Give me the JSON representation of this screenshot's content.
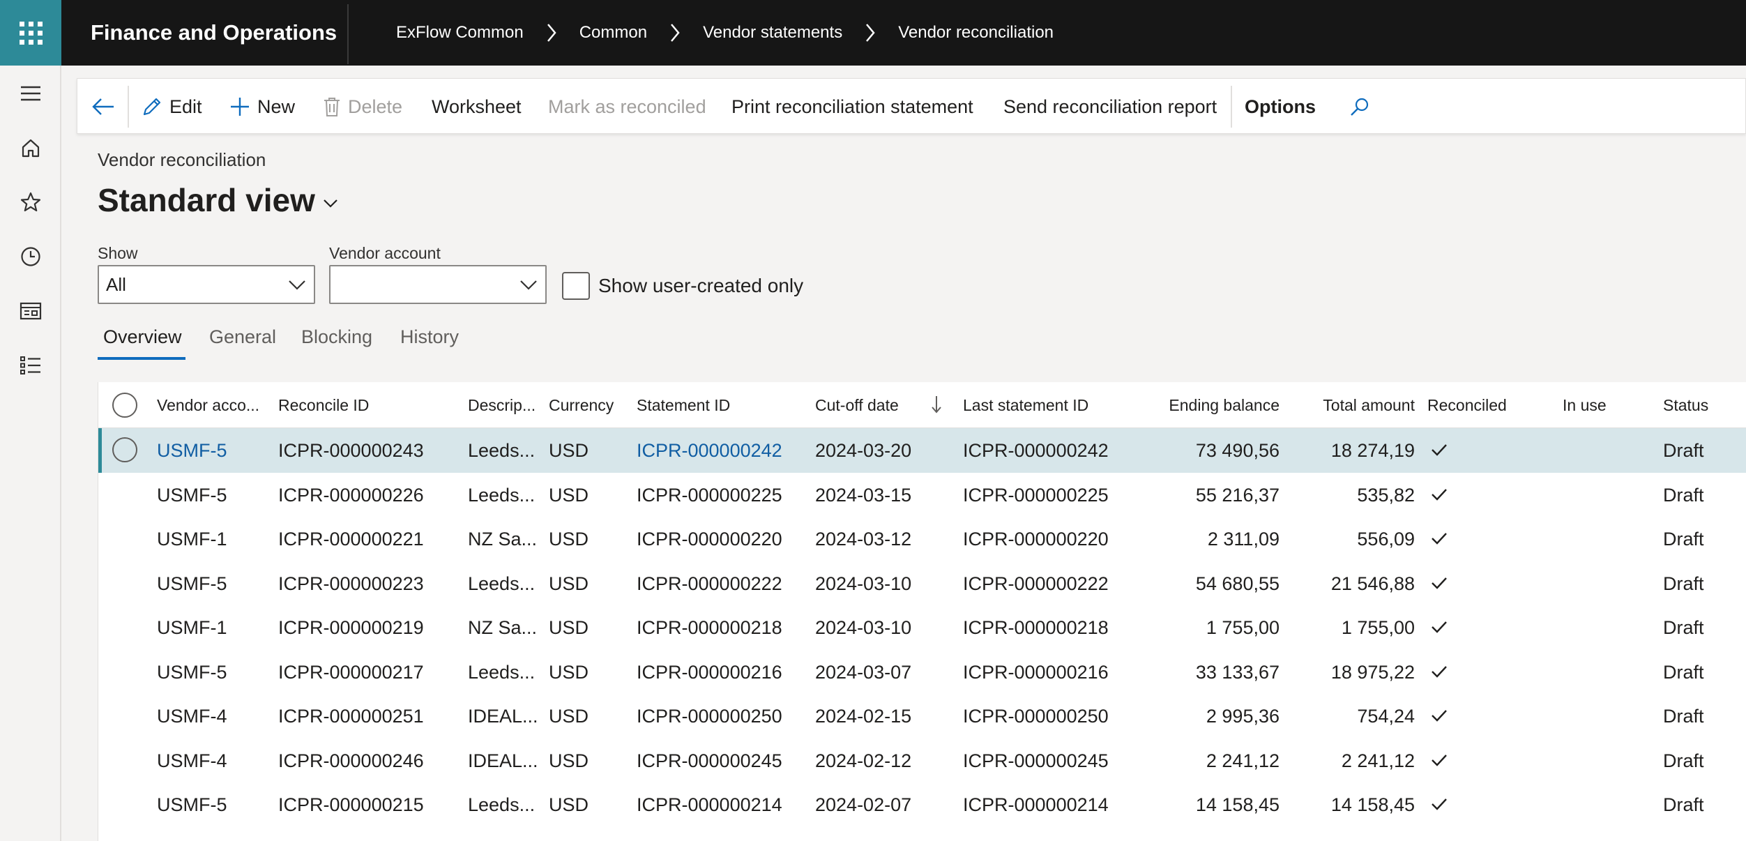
{
  "topbar": {
    "app_title": "Finance and Operations",
    "breadcrumb": [
      "ExFlow Common",
      "Common",
      "Vendor statements",
      "Vendor reconciliation"
    ]
  },
  "actions": {
    "edit": "Edit",
    "new": "New",
    "delete": "Delete",
    "worksheet": "Worksheet",
    "mark_reconciled": "Mark as reconciled",
    "print_statement": "Print reconciliation statement",
    "send_report": "Send reconciliation report",
    "options": "Options"
  },
  "page": {
    "caption": "Vendor reconciliation",
    "view_title": "Standard view"
  },
  "filters": {
    "show_label": "Show",
    "show_value": "All",
    "vendor_label": "Vendor account",
    "vendor_value": "",
    "user_created_label": "Show user-created only"
  },
  "tabs": [
    "Overview",
    "General",
    "Blocking",
    "History"
  ],
  "grid": {
    "headers": {
      "vendor": "Vendor acco...",
      "reconcile_id": "Reconcile ID",
      "description": "Descrip...",
      "currency": "Currency",
      "statement_id": "Statement ID",
      "cutoff": "Cut-off date",
      "last_statement": "Last statement ID",
      "ending_balance": "Ending balance",
      "total_amount": "Total amount",
      "reconciled": "Reconciled",
      "in_use": "In use",
      "status": "Status"
    },
    "rows": [
      {
        "vendor": "USMF-5",
        "reconcile_id": "ICPR-000000243",
        "description": "Leeds...",
        "currency": "USD",
        "statement_id": "ICPR-000000242",
        "cutoff": "2024-03-20",
        "last_statement": "ICPR-000000242",
        "ending_balance": "73 490,56",
        "total_amount": "18 274,19",
        "reconciled": true,
        "in_use": "",
        "status": "Draft"
      },
      {
        "vendor": "USMF-5",
        "reconcile_id": "ICPR-000000226",
        "description": "Leeds...",
        "currency": "USD",
        "statement_id": "ICPR-000000225",
        "cutoff": "2024-03-15",
        "last_statement": "ICPR-000000225",
        "ending_balance": "55 216,37",
        "total_amount": "535,82",
        "reconciled": true,
        "in_use": "",
        "status": "Draft"
      },
      {
        "vendor": "USMF-1",
        "reconcile_id": "ICPR-000000221",
        "description": "NZ Sa...",
        "currency": "USD",
        "statement_id": "ICPR-000000220",
        "cutoff": "2024-03-12",
        "last_statement": "ICPR-000000220",
        "ending_balance": "2 311,09",
        "total_amount": "556,09",
        "reconciled": true,
        "in_use": "",
        "status": "Draft"
      },
      {
        "vendor": "USMF-5",
        "reconcile_id": "ICPR-000000223",
        "description": "Leeds...",
        "currency": "USD",
        "statement_id": "ICPR-000000222",
        "cutoff": "2024-03-10",
        "last_statement": "ICPR-000000222",
        "ending_balance": "54 680,55",
        "total_amount": "21 546,88",
        "reconciled": true,
        "in_use": "",
        "status": "Draft"
      },
      {
        "vendor": "USMF-1",
        "reconcile_id": "ICPR-000000219",
        "description": "NZ Sa...",
        "currency": "USD",
        "statement_id": "ICPR-000000218",
        "cutoff": "2024-03-10",
        "last_statement": "ICPR-000000218",
        "ending_balance": "1 755,00",
        "total_amount": "1 755,00",
        "reconciled": true,
        "in_use": "",
        "status": "Draft"
      },
      {
        "vendor": "USMF-5",
        "reconcile_id": "ICPR-000000217",
        "description": "Leeds...",
        "currency": "USD",
        "statement_id": "ICPR-000000216",
        "cutoff": "2024-03-07",
        "last_statement": "ICPR-000000216",
        "ending_balance": "33 133,67",
        "total_amount": "18 975,22",
        "reconciled": true,
        "in_use": "",
        "status": "Draft"
      },
      {
        "vendor": "USMF-4",
        "reconcile_id": "ICPR-000000251",
        "description": "IDEAL...",
        "currency": "USD",
        "statement_id": "ICPR-000000250",
        "cutoff": "2024-02-15",
        "last_statement": "ICPR-000000250",
        "ending_balance": "2 995,36",
        "total_amount": "754,24",
        "reconciled": true,
        "in_use": "",
        "status": "Draft"
      },
      {
        "vendor": "USMF-4",
        "reconcile_id": "ICPR-000000246",
        "description": "IDEAL...",
        "currency": "USD",
        "statement_id": "ICPR-000000245",
        "cutoff": "2024-02-12",
        "last_statement": "ICPR-000000245",
        "ending_balance": "2 241,12",
        "total_amount": "2 241,12",
        "reconciled": true,
        "in_use": "",
        "status": "Draft"
      },
      {
        "vendor": "USMF-5",
        "reconcile_id": "ICPR-000000215",
        "description": "Leeds...",
        "currency": "USD",
        "statement_id": "ICPR-000000214",
        "cutoff": "2024-02-07",
        "last_statement": "ICPR-000000214",
        "ending_balance": "14 158,45",
        "total_amount": "14 158,45",
        "reconciled": true,
        "in_use": "",
        "status": "Draft"
      }
    ]
  },
  "colors": {
    "topbar": "#161616",
    "waffle": "#2d8a98",
    "link": "#115ea3",
    "selected_row": "#d7e6ea",
    "accent": "#0f6cbd"
  },
  "icons": [
    "app-launcher-icon",
    "menu-icon",
    "home-icon",
    "star-icon",
    "clock-icon",
    "workspace-icon",
    "list-icon",
    "back-icon",
    "pencil-icon",
    "plus-icon",
    "trash-icon",
    "search-icon",
    "chevron-down-icon",
    "sort-arrow-icon",
    "checkmark-icon"
  ]
}
